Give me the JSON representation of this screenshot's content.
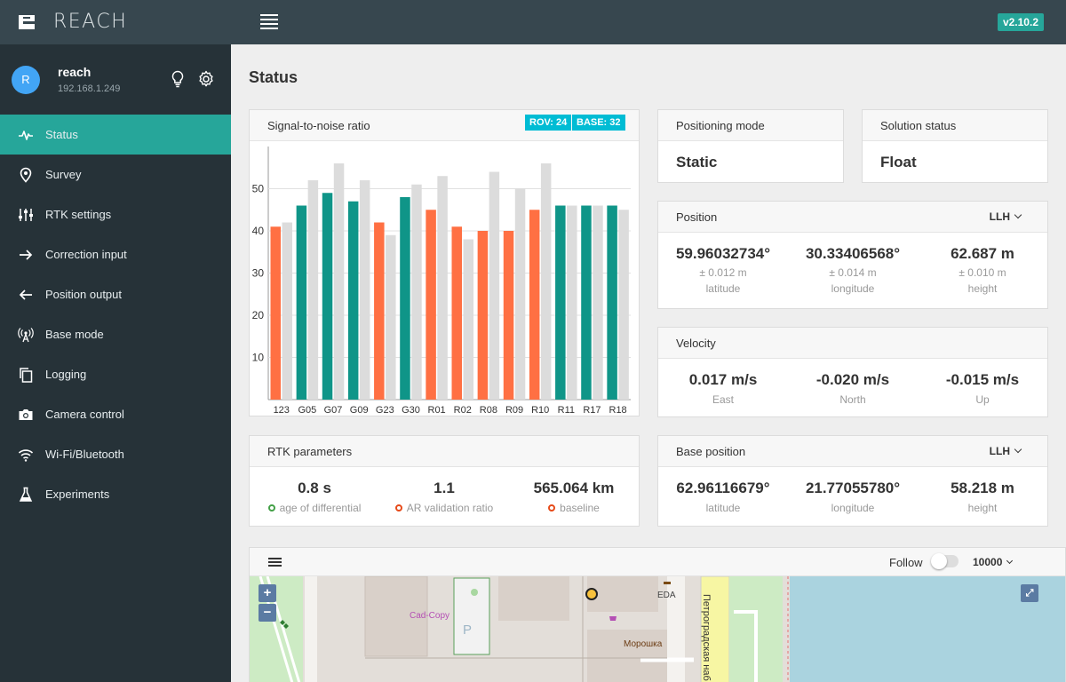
{
  "app": {
    "name": "REACH",
    "version": "v2.10.2"
  },
  "user": {
    "initial": "R",
    "name": "reach",
    "ip": "192.168.1.249"
  },
  "nav": [
    {
      "label": "Status",
      "icon": "pulse-icon"
    },
    {
      "label": "Survey",
      "icon": "location-pin-icon"
    },
    {
      "label": "RTK settings",
      "icon": "sliders-icon"
    },
    {
      "label": "Correction input",
      "icon": "arrow-right-icon"
    },
    {
      "label": "Position output",
      "icon": "arrow-left-icon"
    },
    {
      "label": "Base mode",
      "icon": "antenna-icon"
    },
    {
      "label": "Logging",
      "icon": "copy-icon"
    },
    {
      "label": "Camera control",
      "icon": "camera-icon"
    },
    {
      "label": "Wi-Fi/Bluetooth",
      "icon": "wifi-icon"
    },
    {
      "label": "Experiments",
      "icon": "flask-icon"
    }
  ],
  "page_title": "Status",
  "snr": {
    "title": "Signal-to-noise ratio",
    "rov": "ROV: 24",
    "base": "BASE: 32"
  },
  "chart_data": {
    "type": "bar",
    "categories": [
      "123",
      "G05",
      "G07",
      "G09",
      "G23",
      "G30",
      "R01",
      "R02",
      "R08",
      "R09",
      "R10",
      "R11",
      "R17",
      "R18"
    ],
    "series": [
      {
        "name": "rover",
        "values": [
          41,
          46,
          49,
          47,
          42,
          48,
          45,
          41,
          40,
          40,
          45,
          46,
          46,
          46
        ]
      },
      {
        "name": "base",
        "values": [
          42,
          52,
          56,
          52,
          39,
          51,
          53,
          38,
          54,
          50,
          56,
          46,
          46,
          45
        ]
      }
    ],
    "rover_colors": [
      "#ff7043",
      "#0f9588",
      "#0f9588",
      "#0f9588",
      "#ff7043",
      "#0f9588",
      "#ff7043",
      "#ff7043",
      "#ff7043",
      "#ff7043",
      "#ff7043",
      "#0f9588",
      "#0f9588",
      "#0f9588"
    ],
    "base_color": "#dcdcdc",
    "yticks": [
      10,
      20,
      30,
      40,
      50
    ],
    "ylim": [
      0,
      60
    ]
  },
  "positioning": {
    "title": "Positioning mode",
    "value": "Static"
  },
  "solution": {
    "title": "Solution status",
    "value": "Float"
  },
  "position": {
    "title": "Position",
    "format": "LLH",
    "lat": "59.96032734°",
    "lat_acc": "± 0.012 m",
    "lat_label": "latitude",
    "lon": "30.33406568°",
    "lon_acc": "± 0.014 m",
    "lon_label": "longitude",
    "h": "62.687 m",
    "h_acc": "± 0.010 m",
    "h_label": "height"
  },
  "velocity": {
    "title": "Velocity",
    "east": "0.017 m/s",
    "east_label": "East",
    "north": "-0.020 m/s",
    "north_label": "North",
    "up": "-0.015 m/s",
    "up_label": "Up"
  },
  "rtk": {
    "title": "RTK parameters",
    "age": "0.8 s",
    "age_label": "age of differential",
    "ar": "1.1",
    "ar_label": "AR validation ratio",
    "baseline": "565.064 km",
    "baseline_label": "baseline"
  },
  "base_position": {
    "title": "Base position",
    "format": "LLH",
    "lat": "62.96116679°",
    "lat_label": "latitude",
    "lon": "21.77055780°",
    "lon_label": "longitude",
    "h": "58.218 m",
    "h_label": "height"
  },
  "map": {
    "follow_label": "Follow",
    "zoom": "10000",
    "zoom_in": "+",
    "zoom_out": "−",
    "poi": [
      "Cad-Copy",
      "EDA",
      "Морошка",
      "Петроградская наб",
      "P"
    ]
  }
}
